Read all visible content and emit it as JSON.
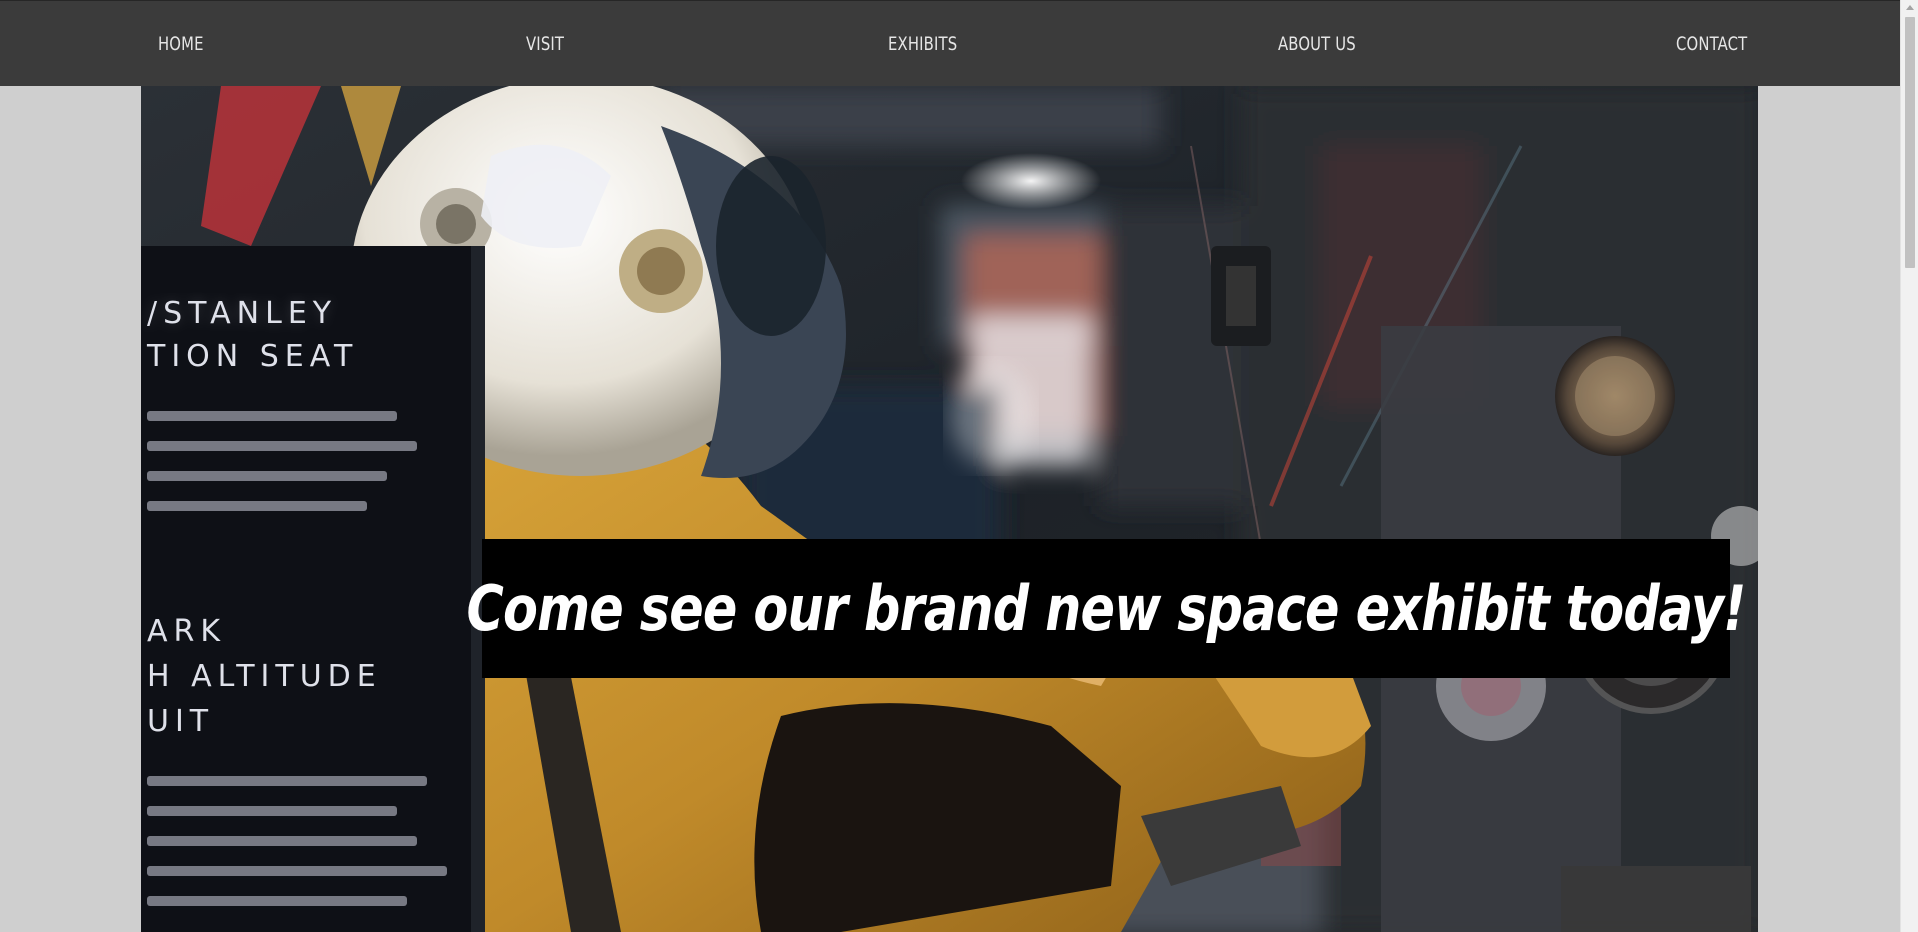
{
  "nav": {
    "items": [
      {
        "label": "HOME"
      },
      {
        "label": "VISIT"
      },
      {
        "label": "EXHIBITS"
      },
      {
        "label": "ABOUT US"
      },
      {
        "label": "CONTACT"
      }
    ]
  },
  "hero": {
    "banner_text": "Come see our brand new space exhibit today!",
    "image_signage_text": [
      "/STANLEY",
      "TION SEAT",
      "ARK",
      "H ALTITUDE",
      "UIT"
    ]
  },
  "colors": {
    "navbar_bg": "#3b3b3b",
    "nav_text": "#e6e6e6",
    "page_bg": "#cfcfcf",
    "banner_bg": "#000000",
    "banner_text": "#ffffff",
    "suit_yellow": "#c9952e"
  }
}
